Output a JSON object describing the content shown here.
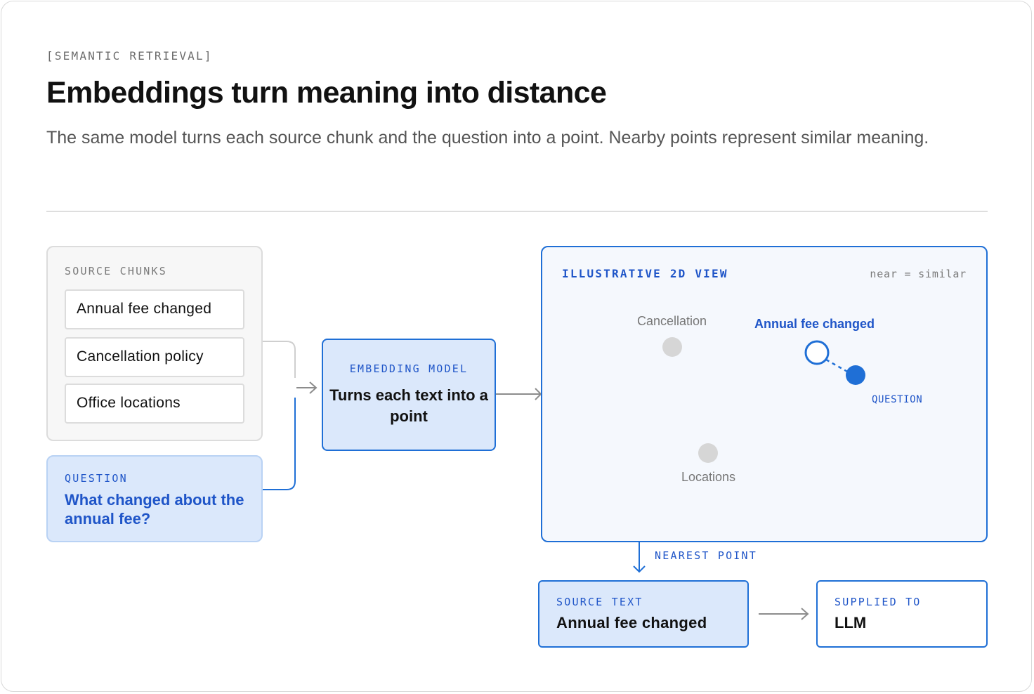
{
  "header": {
    "eyebrow": "[SEMANTIC RETRIEVAL]",
    "title": "Embeddings turn meaning into distance",
    "subtitle": "The same model turns each source chunk and the question into a point. Nearby points represent similar meaning."
  },
  "sources": {
    "label": "SOURCE CHUNKS",
    "chunks": [
      "Annual fee changed",
      "Cancellation policy",
      "Office locations"
    ]
  },
  "question": {
    "label": "QUESTION",
    "text": "What changed about the annual fee?"
  },
  "embedding": {
    "label": "EMBEDDING MODEL",
    "text": "Turns each text into a point"
  },
  "view": {
    "label": "ILLUSTRATIVE 2D VIEW",
    "note": "near = similar",
    "points": {
      "cancellation": "Cancellation",
      "annual_fee": "Annual fee changed",
      "question": "QUESTION",
      "locations": "Locations"
    }
  },
  "nearest": {
    "label": "NEAREST POINT"
  },
  "source_text": {
    "label": "SOURCE TEXT",
    "value": "Annual fee changed"
  },
  "supplied": {
    "label": "SUPPLIED TO",
    "value": "LLM"
  },
  "colors": {
    "accent": "#1f6fd6",
    "accent_text": "#1f55c8",
    "light_fill": "#dbe8fb",
    "muted_point": "#d6d6d6"
  }
}
